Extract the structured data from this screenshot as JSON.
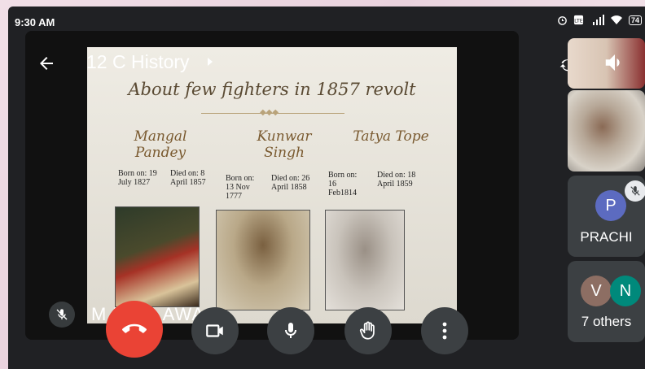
{
  "status_bar": {
    "time": "9:30 AM",
    "battery": "74",
    "icons": [
      "alarm-icon",
      "volte-icon",
      "signal-4g-icon",
      "wifi-icon",
      "battery-icon"
    ]
  },
  "meeting": {
    "title": "12 C History",
    "presenter_name": "M     U RA      AWA"
  },
  "slide": {
    "title": "About few fighters in 1857 revolt",
    "fighters": [
      {
        "name_line1": "Mangal",
        "name_line2": "Pandey",
        "born": "Born on: 19 July 1827",
        "died": "Died on: 8 April 1857"
      },
      {
        "name_line1": "Kunwar",
        "name_line2": "Singh",
        "born": "Born on: 13 Nov 1777",
        "died": "Died on: 26 April 1858"
      },
      {
        "name_line1": "Tatya Tope",
        "name_line2": "",
        "born": "Born on: 16 Feb1814",
        "died": "Died on: 18 April 1859"
      }
    ]
  },
  "participants": [
    {
      "initial": "P",
      "name": "PRACHI",
      "color": "#5c6bc0",
      "muted": true
    },
    {
      "initials": [
        "V",
        "N"
      ],
      "label": "7 others",
      "colors": [
        "#8d6e63",
        "#00897b"
      ]
    }
  ],
  "colors": {
    "end_call": "#ea4335",
    "control_bg": "#3c4043",
    "background": "#202124"
  }
}
